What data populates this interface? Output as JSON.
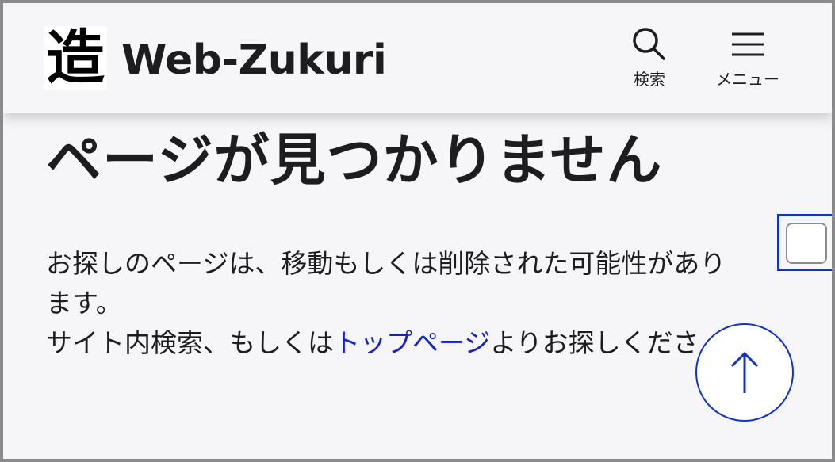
{
  "header": {
    "logo_char": "造",
    "site_name": "Web-Zukuri",
    "search_label": "検索",
    "menu_label": "メニュー"
  },
  "main": {
    "title": "ページが見つかりません",
    "line1": "お探しのページは、移動もしくは削除された可能性があり",
    "line2": "ます。",
    "line3_pre": "サイト内検索、もしくは",
    "top_link": "トップページ",
    "line3_post": "よりお探しくださ"
  },
  "icons": {
    "search": "search-icon",
    "menu": "hamburger-icon",
    "back_to_top": "arrow-up-icon"
  },
  "colors": {
    "link": "#1520c8",
    "accent": "#1232c8",
    "background": "#f6f6f8"
  }
}
